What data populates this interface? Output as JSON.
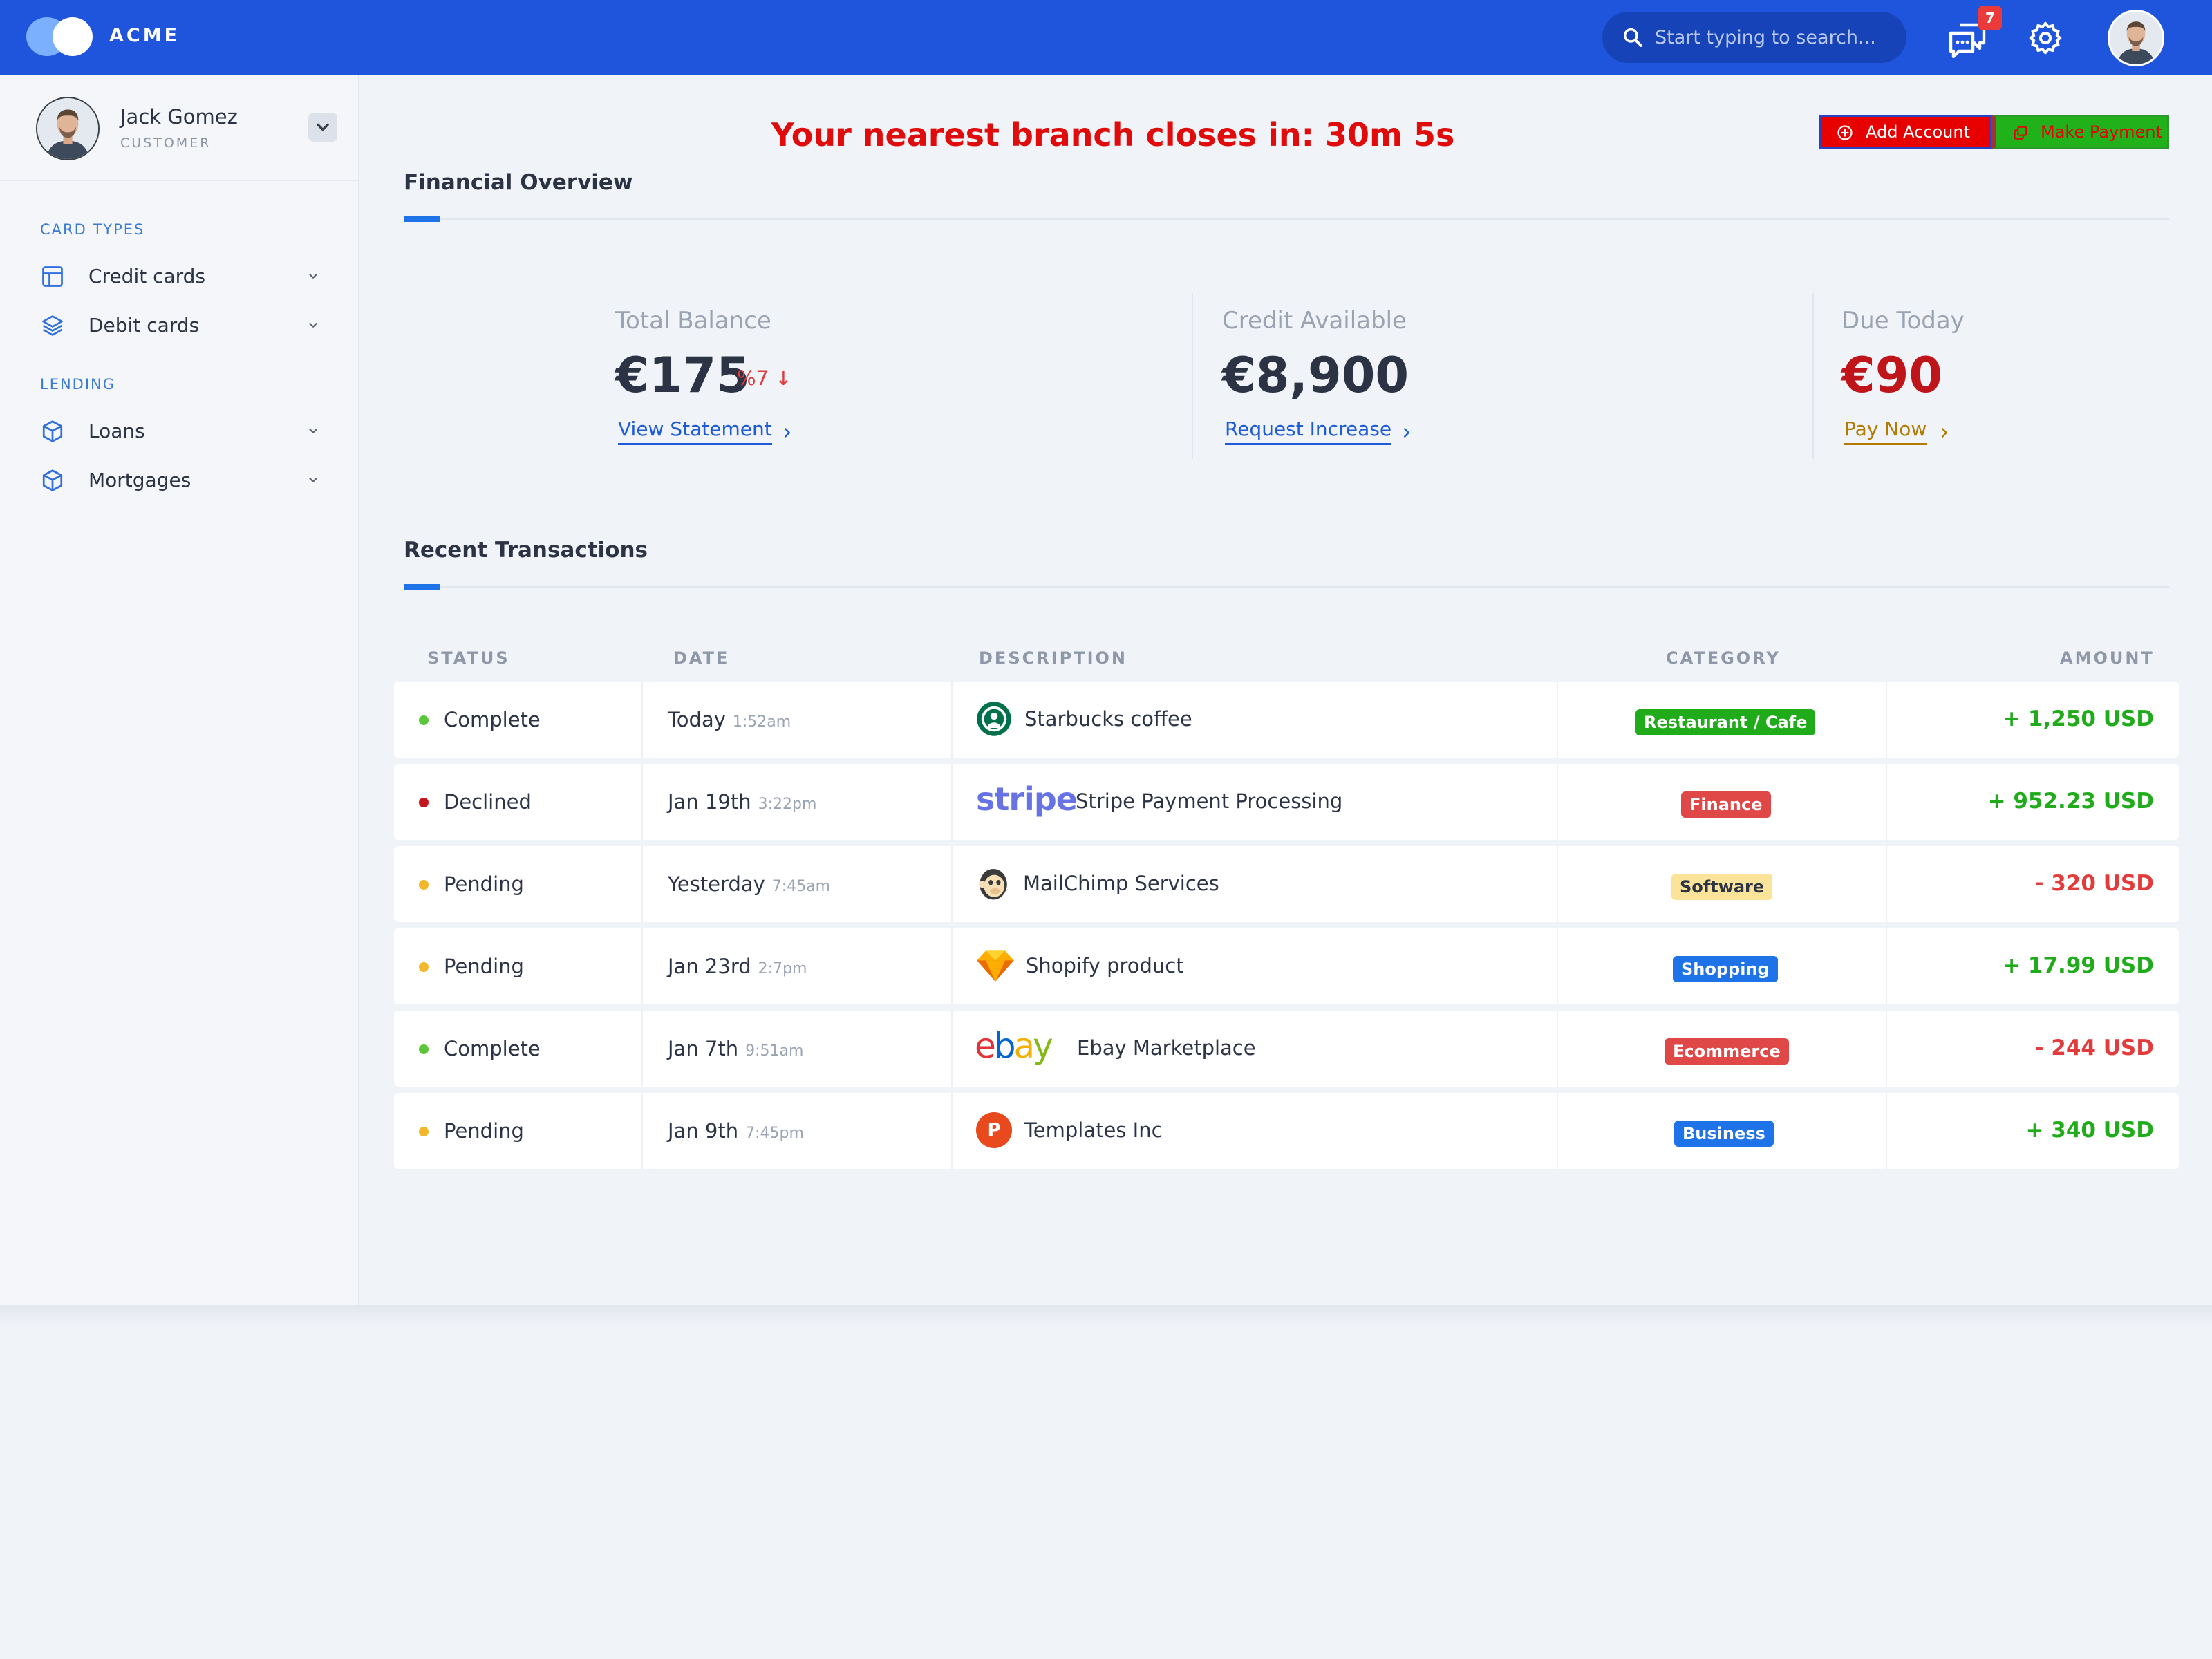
{
  "app": {
    "brand": "ACME"
  },
  "header": {
    "search_placeholder": "Start typing to search...",
    "notifications_count": "7"
  },
  "user": {
    "name": "Jack Gomez",
    "role": "CUSTOMER"
  },
  "sidebar": {
    "sections": [
      {
        "title": "CARD TYPES",
        "items": [
          {
            "label": "Credit cards",
            "icon": "credit-card-icon"
          },
          {
            "label": "Debit cards",
            "icon": "layers-icon"
          }
        ]
      },
      {
        "title": "LENDING",
        "items": [
          {
            "label": "Loans",
            "icon": "box-icon"
          },
          {
            "label": "Mortgages",
            "icon": "box-icon"
          }
        ]
      }
    ]
  },
  "banner": {
    "timer_text": "Your nearest branch closes in: 30m 5s"
  },
  "actions": {
    "add_account": "Add Account",
    "make_payment": "Make Payment"
  },
  "overview": {
    "title": "Financial Overview",
    "stats": [
      {
        "label": "Total Balance",
        "value": "€175",
        "change": "%7",
        "change_arrow": "↓",
        "link": "View Statement",
        "value_color": "#2b3345",
        "link_color": "#1e5bd8"
      },
      {
        "label": "Credit Available",
        "value": "€8,900",
        "link": "Request Increase",
        "value_color": "#2b3345",
        "link_color": "#1e5bd8"
      },
      {
        "label": "Due Today",
        "value": "€90",
        "link": "Pay Now",
        "value_color": "#c0141b",
        "link_color": "#b27b00"
      }
    ]
  },
  "transactions": {
    "title": "Recent Transactions",
    "columns": [
      "STATUS",
      "DATE",
      "DESCRIPTION",
      "CATEGORY",
      "AMOUNT"
    ],
    "rows": [
      {
        "status": "Complete",
        "status_color": "#5cc63a",
        "date": "Today",
        "time": "1:52am",
        "merchant": "Starbucks coffee",
        "logo": "starbucks-logo",
        "category": "Restaurant / Cafe",
        "category_bg": "#1fab1a",
        "category_fg": "#ffffff",
        "amount": "+ 1,250 USD",
        "amount_color": "#1fab1a"
      },
      {
        "status": "Declined",
        "status_color": "#c4161c",
        "date": "Jan 19th",
        "time": "3:22pm",
        "merchant": "Stripe Payment Processing",
        "logo": "stripe-logo",
        "category": "Finance",
        "category_bg": "#e04848",
        "category_fg": "#ffffff",
        "amount": "+ 952.23 USD",
        "amount_color": "#1fab1a"
      },
      {
        "status": "Pending",
        "status_color": "#f2b72b",
        "date": "Yesterday",
        "time": "7:45am",
        "merchant": "MailChimp Services",
        "logo": "mailchimp-logo",
        "category": "Software",
        "category_bg": "#fbe39a",
        "category_fg": "#2b3345",
        "amount": "- 320 USD",
        "amount_color": "#e23b3b"
      },
      {
        "status": "Pending",
        "status_color": "#f2b72b",
        "date": "Jan 23rd",
        "time": "2:7pm",
        "merchant": "Shopify product",
        "logo": "sketch-logo",
        "category": "Shopping",
        "category_bg": "#1e73e8",
        "category_fg": "#ffffff",
        "amount": "+ 17.99 USD",
        "amount_color": "#1fab1a"
      },
      {
        "status": "Complete",
        "status_color": "#5cc63a",
        "date": "Jan 7th",
        "time": "9:51am",
        "merchant": "Ebay Marketplace",
        "logo": "ebay-logo",
        "category": "Ecommerce",
        "category_bg": "#e04848",
        "category_fg": "#ffffff",
        "amount": "- 244 USD",
        "amount_color": "#e23b3b"
      },
      {
        "status": "Pending",
        "status_color": "#f2b72b",
        "date": "Jan 9th",
        "time": "7:45pm",
        "merchant": "Templates Inc",
        "logo": "product-hunt-logo",
        "category": "Business",
        "category_bg": "#1e73e8",
        "category_fg": "#ffffff",
        "amount": "+ 340 USD",
        "amount_color": "#1fab1a"
      }
    ]
  },
  "logos": {
    "stripe": "stripe",
    "ebay": [
      "e",
      "b",
      "a",
      "y"
    ],
    "templates": "P"
  }
}
